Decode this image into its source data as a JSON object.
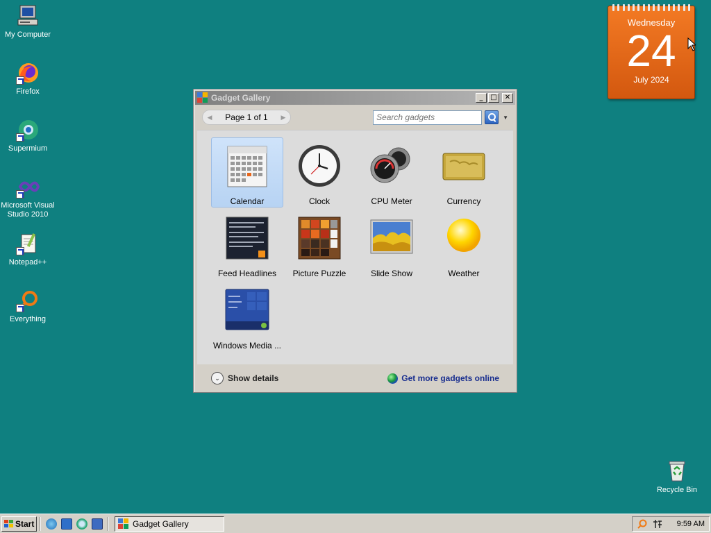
{
  "desktop": {
    "icons": [
      {
        "label": "My Computer",
        "icon": "computer-icon"
      },
      {
        "label": "Firefox",
        "icon": "firefox-icon"
      },
      {
        "label": "Supermium",
        "icon": "supermium-icon"
      },
      {
        "label": "Microsoft Visual Studio 2010",
        "icon": "visual-studio-icon"
      },
      {
        "label": "Notepad++",
        "icon": "notepad-plus-plus-icon"
      },
      {
        "label": "Everything",
        "icon": "everything-search-icon"
      },
      {
        "label": "Recycle Bin",
        "icon": "recycle-bin-icon"
      }
    ]
  },
  "calendar_widget": {
    "weekday": "Wednesday",
    "day": "24",
    "month_year": "July 2024",
    "color": "#e8661a"
  },
  "window": {
    "title": "Gadget Gallery",
    "minimize": "_",
    "maximize": "□",
    "close": "✕",
    "pager": {
      "prev": "◀",
      "page_label": "Page 1 of 1",
      "next": "▶"
    },
    "search": {
      "placeholder": "Search gadgets",
      "dropdown": "▼"
    },
    "gadgets": [
      {
        "name": "Calendar",
        "icon": "calendar-gadget-icon",
        "selected": true
      },
      {
        "name": "Clock",
        "icon": "clock-gadget-icon",
        "selected": false
      },
      {
        "name": "CPU Meter",
        "icon": "cpu-meter-gadget-icon",
        "selected": false
      },
      {
        "name": "Currency",
        "icon": "currency-gadget-icon",
        "selected": false
      },
      {
        "name": "Feed Headlines",
        "icon": "feed-headlines-gadget-icon",
        "selected": false
      },
      {
        "name": "Picture Puzzle",
        "icon": "picture-puzzle-gadget-icon",
        "selected": false
      },
      {
        "name": "Slide Show",
        "icon": "slide-show-gadget-icon",
        "selected": false
      },
      {
        "name": "Weather",
        "icon": "weather-gadget-icon",
        "selected": false
      },
      {
        "name": "Windows Media ...",
        "icon": "windows-media-gadget-icon",
        "selected": false
      }
    ],
    "footer": {
      "show_details": "Show details",
      "details_chevron": "⌄",
      "more_online": "Get more gadgets online"
    }
  },
  "taskbar": {
    "start": "Start",
    "task_button": "Gadget Gallery",
    "clock": "9:59 AM"
  },
  "colors": {
    "desktop": "#0f8080",
    "selection": "#c3dbf7",
    "link": "#1a2f8f"
  }
}
